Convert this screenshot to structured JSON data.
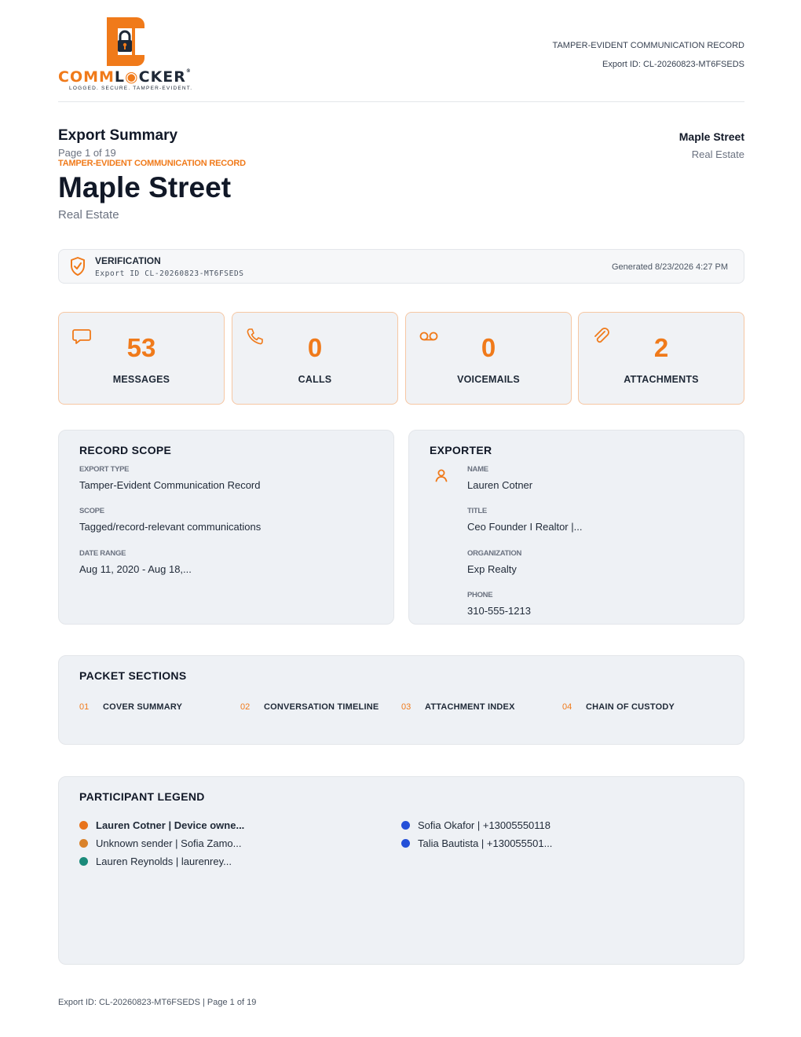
{
  "brand": {
    "word_left": "COMM",
    "word_lock": "L",
    "word_lock2": "CKER",
    "trademark": "®",
    "tagline": "LOGGED. SECURE. TAMPER-EVIDENT.",
    "accent_color": "#f07a1a"
  },
  "header": {
    "doc_type": "TAMPER-EVIDENT COMMUNICATION RECORD",
    "export_id": "Export ID: CL-20260823-MT6FSEDS"
  },
  "summary": {
    "title": "Export Summary",
    "page_indicator": "Page 1 of 19",
    "eyebrow": "TAMPER-EVIDENT COMMUNICATION RECORD",
    "big_title": "Maple Street",
    "subtitle": "Real Estate",
    "right_name": "Maple Street",
    "right_category": "Real Estate"
  },
  "verification": {
    "icon": "shield-check-icon",
    "label": "VERIFICATION",
    "export_id": "Export ID CL-20260823-MT6FSEDS",
    "generated": "Generated 8/23/2026 4:27 PM"
  },
  "stats": [
    {
      "icon": "message-icon",
      "value": "53",
      "label": "MESSAGES"
    },
    {
      "icon": "phone-icon",
      "value": "0",
      "label": "CALLS"
    },
    {
      "icon": "voicemail-icon",
      "value": "0",
      "label": "VOICEMAILS"
    },
    {
      "icon": "paperclip-icon",
      "value": "2",
      "label": "ATTACHMENTS"
    }
  ],
  "record_scope": {
    "title": "RECORD SCOPE",
    "fields": [
      {
        "label": "EXPORT TYPE",
        "value": "Tamper-Evident Communication Record"
      },
      {
        "label": "SCOPE",
        "value": "Tagged/record-relevant communications"
      },
      {
        "label": "DATE RANGE",
        "value": "Aug 11, 2020 - Aug 18,..."
      }
    ]
  },
  "exporter": {
    "title": "EXPORTER",
    "icon": "user-icon",
    "fields": [
      {
        "label": "NAME",
        "value": "Lauren Cotner"
      },
      {
        "label": "TITLE",
        "value": "Ceo Founder I Realtor |..."
      },
      {
        "label": "ORGANIZATION",
        "value": "Exp Realty"
      },
      {
        "label": "PHONE",
        "value": "310-555-1213"
      }
    ]
  },
  "packet_sections": {
    "title": "PACKET SECTIONS",
    "items": [
      {
        "num": "01",
        "label": "COVER SUMMARY"
      },
      {
        "num": "02",
        "label": "CONVERSATION TIMELINE"
      },
      {
        "num": "03",
        "label": "ATTACHMENT INDEX"
      },
      {
        "num": "04",
        "label": "CHAIN OF CUSTODY"
      }
    ]
  },
  "legend": {
    "title": "PARTICIPANT LEGEND",
    "items": [
      {
        "text": "Lauren Cotner | Device owne...",
        "color": "#e8731c",
        "bold": true
      },
      {
        "text": "Unknown sender | Sofia Zamo...",
        "color": "#d9822b",
        "bold": false
      },
      {
        "text": "Lauren Reynolds | laurenrey...",
        "color": "#1a8a7a",
        "bold": false
      },
      {
        "text": "Sofia Okafor | +13005550118",
        "color": "#2450d8",
        "bold": false
      },
      {
        "text": "Talia Bautista | +130055501...",
        "color": "#2450d8",
        "bold": false
      }
    ]
  },
  "footer": {
    "text": "Export ID: CL-20260823-MT6FSEDS | Page 1 of 19"
  }
}
